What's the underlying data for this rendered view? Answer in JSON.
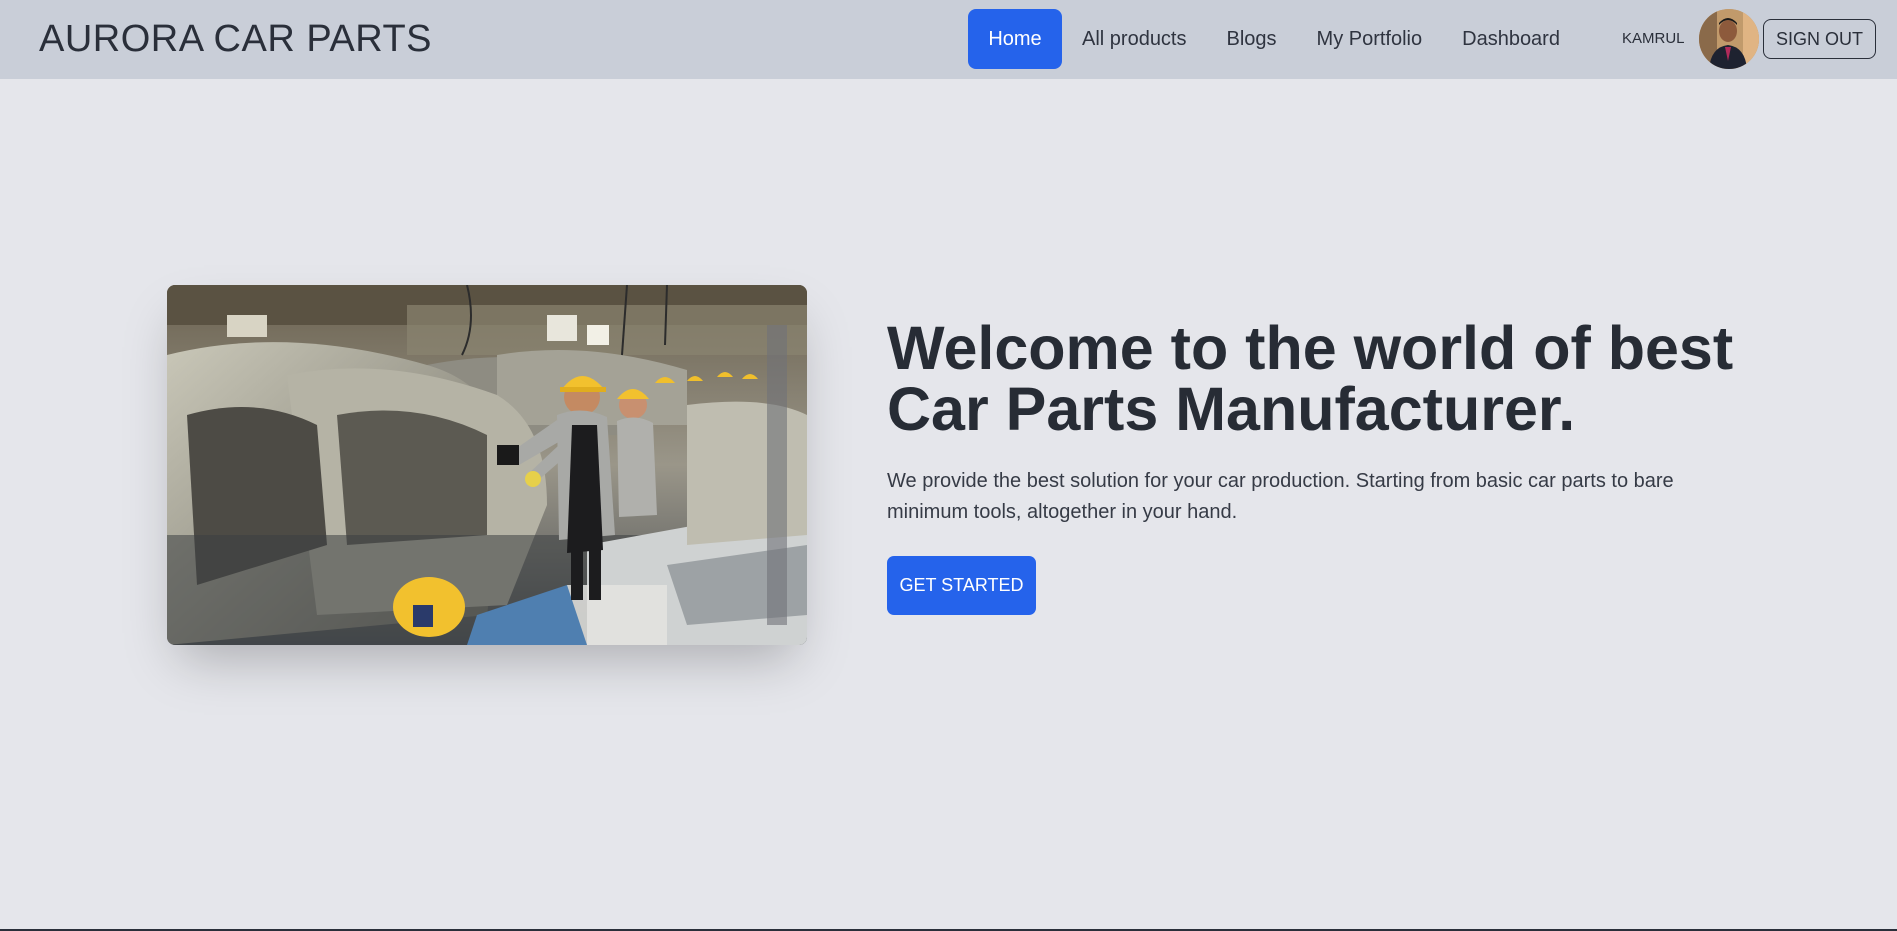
{
  "navbar": {
    "brand": "AURORA CAR PARTS",
    "items": [
      {
        "label": "Home",
        "active": true
      },
      {
        "label": "All products",
        "active": false
      },
      {
        "label": "Blogs",
        "active": false
      },
      {
        "label": "My Portfolio",
        "active": false
      },
      {
        "label": "Dashboard",
        "active": false
      }
    ],
    "user_name": "KAMRUL",
    "sign_out_label": "SIGN OUT"
  },
  "hero": {
    "title": "Welcome to the world of best Car Parts Manufacturer.",
    "description": "We provide the best solution for your car production. Starting from basic car parts to bare minimum tools, altogether in your hand.",
    "cta_label": "GET STARTED"
  },
  "colors": {
    "accent": "#2563eb",
    "navbar_bg": "#c9ced8",
    "page_bg": "#e5e6eb",
    "text": "#272c35"
  }
}
